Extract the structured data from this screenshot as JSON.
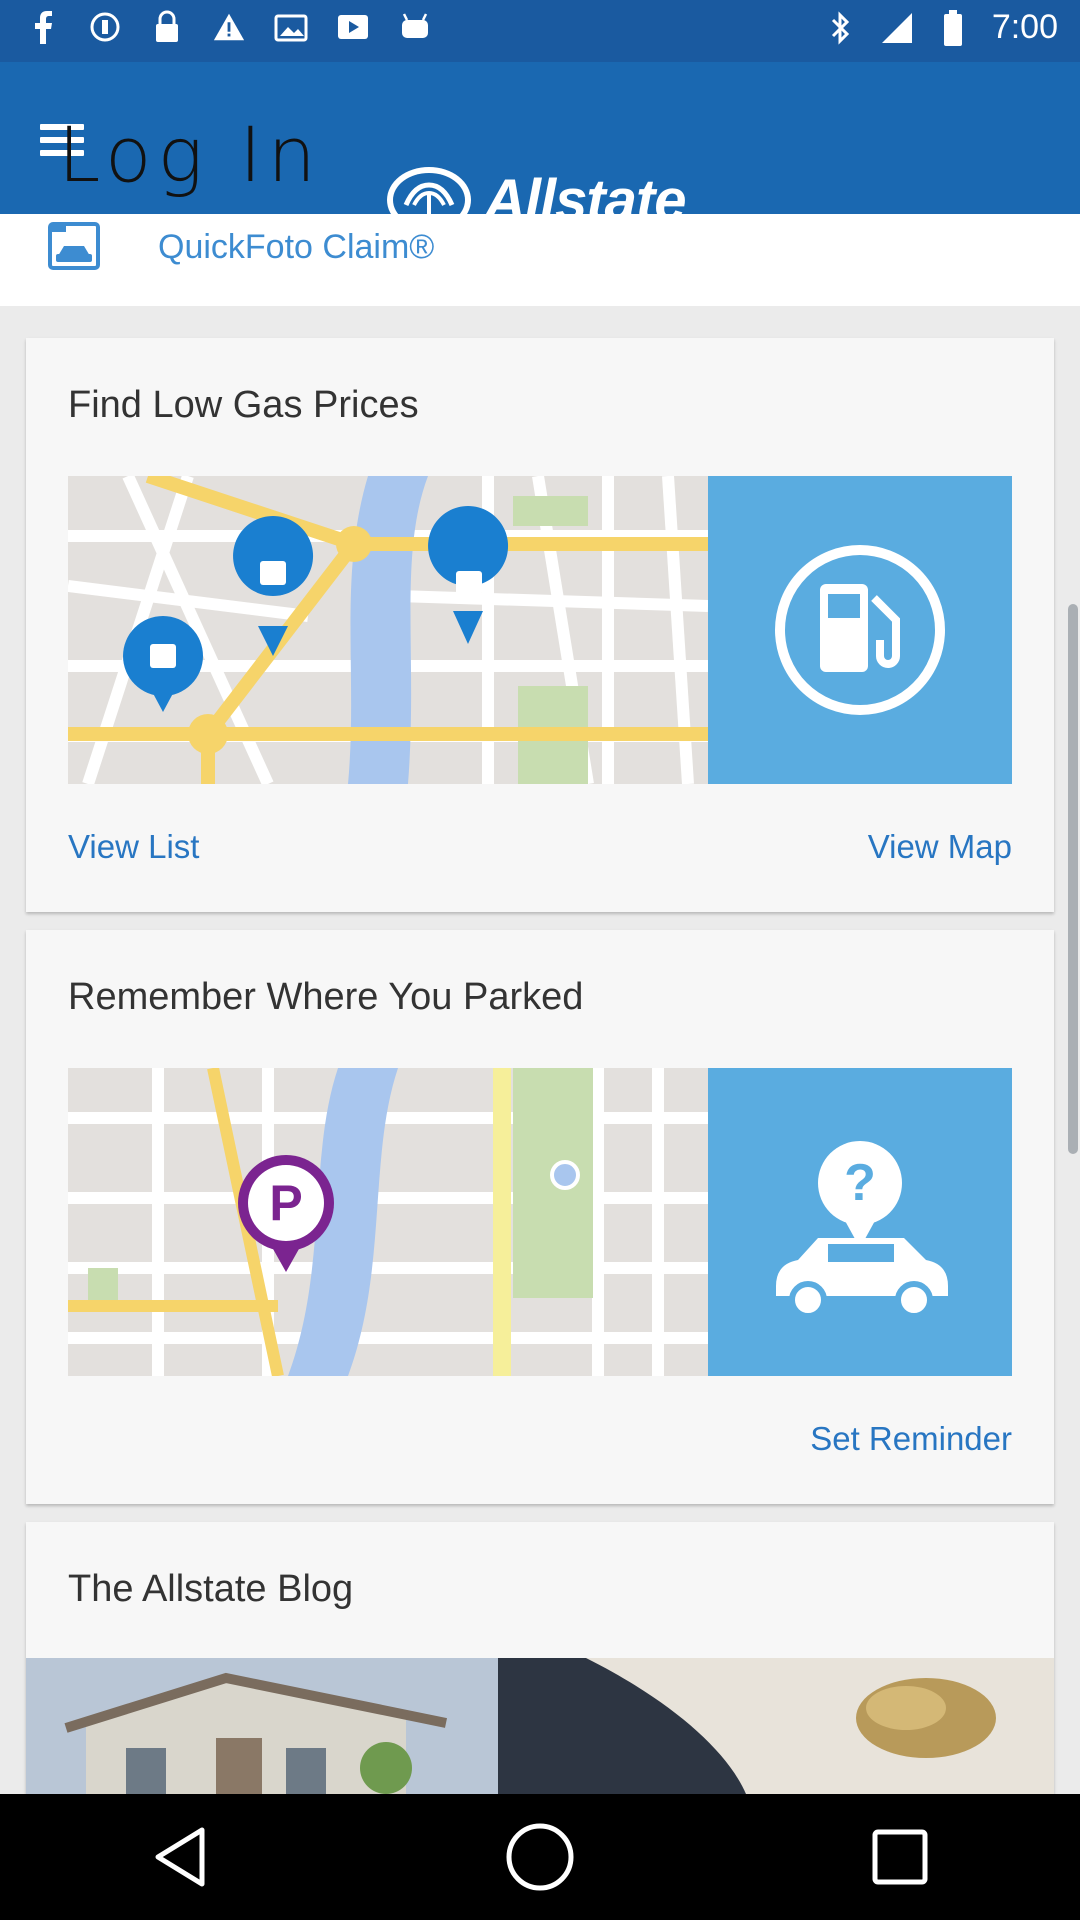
{
  "status_bar": {
    "time": "7:00",
    "left_icons": [
      "facebook-icon",
      "stop-circle-icon",
      "lock-icon",
      "warning-icon",
      "photo-icon",
      "video-icon",
      "android-icon"
    ],
    "right_icons": [
      "bluetooth-icon",
      "signal-icon",
      "battery-icon"
    ]
  },
  "app_bar": {
    "login_text": "Log In",
    "brand": "Allstate",
    "menu_icon": "menu-icon"
  },
  "quickfoto": {
    "label": "QuickFoto Claim®",
    "icon": "camera-car-icon"
  },
  "cards": {
    "gas": {
      "title": "Find Low Gas Prices",
      "view_list": "View List",
      "view_map": "View Map",
      "icon": "gas-pump-icon"
    },
    "parking": {
      "title": "Remember Where You Parked",
      "set_reminder": "Set Reminder",
      "marker_letter": "P",
      "icon": "car-location-icon",
      "question_mark": "?"
    },
    "blog": {
      "title": "The Allstate Blog"
    }
  },
  "colors": {
    "status_bar": "#1a5aa0",
    "app_bar": "#1a68b1",
    "link": "#2876c2",
    "accent_blue": "#5aace0",
    "pin_blue": "#1a7fd0",
    "pin_purple": "#7b2490"
  },
  "nav_bar": {
    "icons": [
      "back-icon",
      "home-icon",
      "recents-icon"
    ]
  }
}
